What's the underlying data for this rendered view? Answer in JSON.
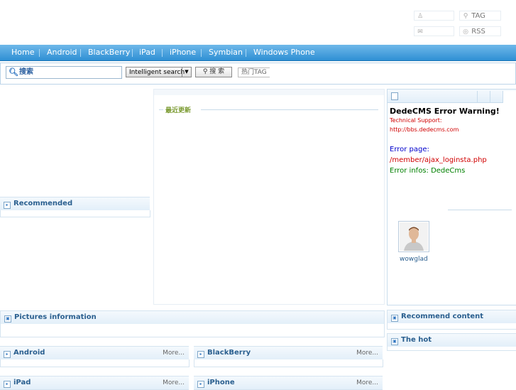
{
  "top_links": {
    "user_icon": "user-icon",
    "tag_label": "TAG",
    "mail_icon": "mail-icon",
    "rss_label": "RSS"
  },
  "nav": {
    "items": [
      "Home",
      "Android",
      "BlackBerry",
      "iPad",
      "iPhone",
      "Symbian",
      "Windows Phone"
    ]
  },
  "search": {
    "input_label": "搜索",
    "select_value": "Intelligent search",
    "button_label": "搜 索",
    "hot_tag": "热门TAG"
  },
  "panels": {
    "recommended": "Recommended",
    "recent_updates": "最近更新",
    "pictures": "Pictures information",
    "recommend_content": "Recommend content",
    "the_hot": "The hot",
    "android": "Android",
    "blackberry": "BlackBerry",
    "ipad": "iPad",
    "iphone": "iPhone",
    "more": "More..."
  },
  "error": {
    "title": "DedeCMS Error Warning!",
    "support_label": "Technical Support:",
    "support_url": "http://bbs.dedecms.com",
    "page_label": "Error page:",
    "page_path": "/member/ajax_loginsta.php",
    "infos": "Error infos: DedeCms"
  },
  "user": {
    "name": "wowglad"
  }
}
